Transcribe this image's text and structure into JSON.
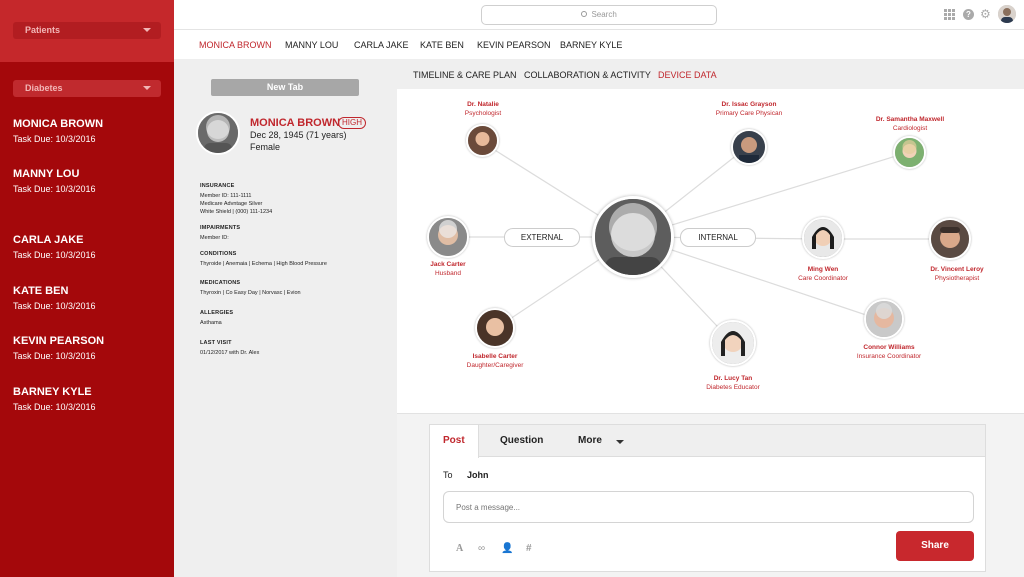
{
  "sidebar": {
    "patients_select": "Patients",
    "filter_select": "Diabetes",
    "patients": [
      {
        "name": "MONICA BROWN",
        "due": "Task Due: 10/3/2016"
      },
      {
        "name": "MANNY LOU",
        "due": "Task Due: 10/3/2016"
      },
      {
        "name": "CARLA JAKE",
        "due": "Task Due: 10/3/2016"
      },
      {
        "name": "KATE BEN",
        "due": "Task Due: 10/3/2016"
      },
      {
        "name": "KEVIN PEARSON",
        "due": "Task Due: 10/3/2016"
      },
      {
        "name": "BARNEY KYLE",
        "due": "Task Due: 10/3/2016"
      }
    ]
  },
  "topbar": {
    "search_placeholder": "Search",
    "icons": [
      "apps-grid-icon",
      "help-icon",
      "gear-icon",
      "user-avatar"
    ]
  },
  "patient_tabs": [
    "MONICA BROWN",
    "MANNY LOU",
    "CARLA JAKE",
    "KATE BEN",
    "KEVIN PEARSON",
    "BARNEY KYLE"
  ],
  "info": {
    "new_tab": "New Tab",
    "name": "MONICA BROWN",
    "risk": "HIGH",
    "dob": "Dec 28, 1945 (71 years)",
    "sex": "Female",
    "insurance_title": "INSURANCE",
    "insurance_lines": [
      "Member ID: 111-1111",
      "Medicare Advntage Silver",
      "White Shield  |  (000) 111-1234"
    ],
    "impairments_title": "IMPAIRMENTS",
    "impairments_lines": [
      "Member ID:"
    ],
    "conditions_title": "CONDITIONS",
    "conditions_lines": [
      "Thyroide  |  Anemaia  |  Echema  |  High Blood Pressure"
    ],
    "medications_title": "MEDICATIONS",
    "medications_lines": [
      "Thyroxin  |  Co Easy Day  |  Norvasc  |  Evion"
    ],
    "allergies_title": "ALLERGIES",
    "allergies_lines": [
      "Asthama"
    ],
    "lastvisit_title": "LAST VISIT",
    "lastvisit_lines": [
      "01/12/2017 with Dr. Alex"
    ]
  },
  "sub_tabs": [
    "TIMELINE & CARE PLAN",
    "COLLABORATION & ACTIVITY",
    "DEVICE DATA"
  ],
  "network": {
    "external_label": "EXTERNAL",
    "internal_label": "INTERNAL",
    "nodes": [
      {
        "name": "Dr. Natalie",
        "role": "Psychologist"
      },
      {
        "name": "Dr. Issac Grayson",
        "role": "Primary Care Physican"
      },
      {
        "name": "Dr. Samantha Maxwell",
        "role": "Cardiologist"
      },
      {
        "name": "Jack Carter",
        "role": "Husband"
      },
      {
        "name": "Ming Wen",
        "role": "Care Coordinator"
      },
      {
        "name": "Dr. Vincent Leroy",
        "role": "Physiotherapist"
      },
      {
        "name": "Isabelle Carter",
        "role": "Daughter/Caregiver"
      },
      {
        "name": "Dr. Lucy Tan",
        "role": "Diabetes Educator"
      },
      {
        "name": "Connor Williams",
        "role": "Insurance Coordinator"
      }
    ]
  },
  "post": {
    "tabs": [
      "Post",
      "Question",
      "More"
    ],
    "to_label": "To",
    "to_value": "John",
    "placeholder": "Post a message...",
    "tools": [
      "text-format-icon",
      "link-icon",
      "add-user-icon",
      "hashtag-icon"
    ],
    "share": "Share"
  },
  "colors": {
    "accent": "#c0272d",
    "sidebar": "#a4080b"
  }
}
